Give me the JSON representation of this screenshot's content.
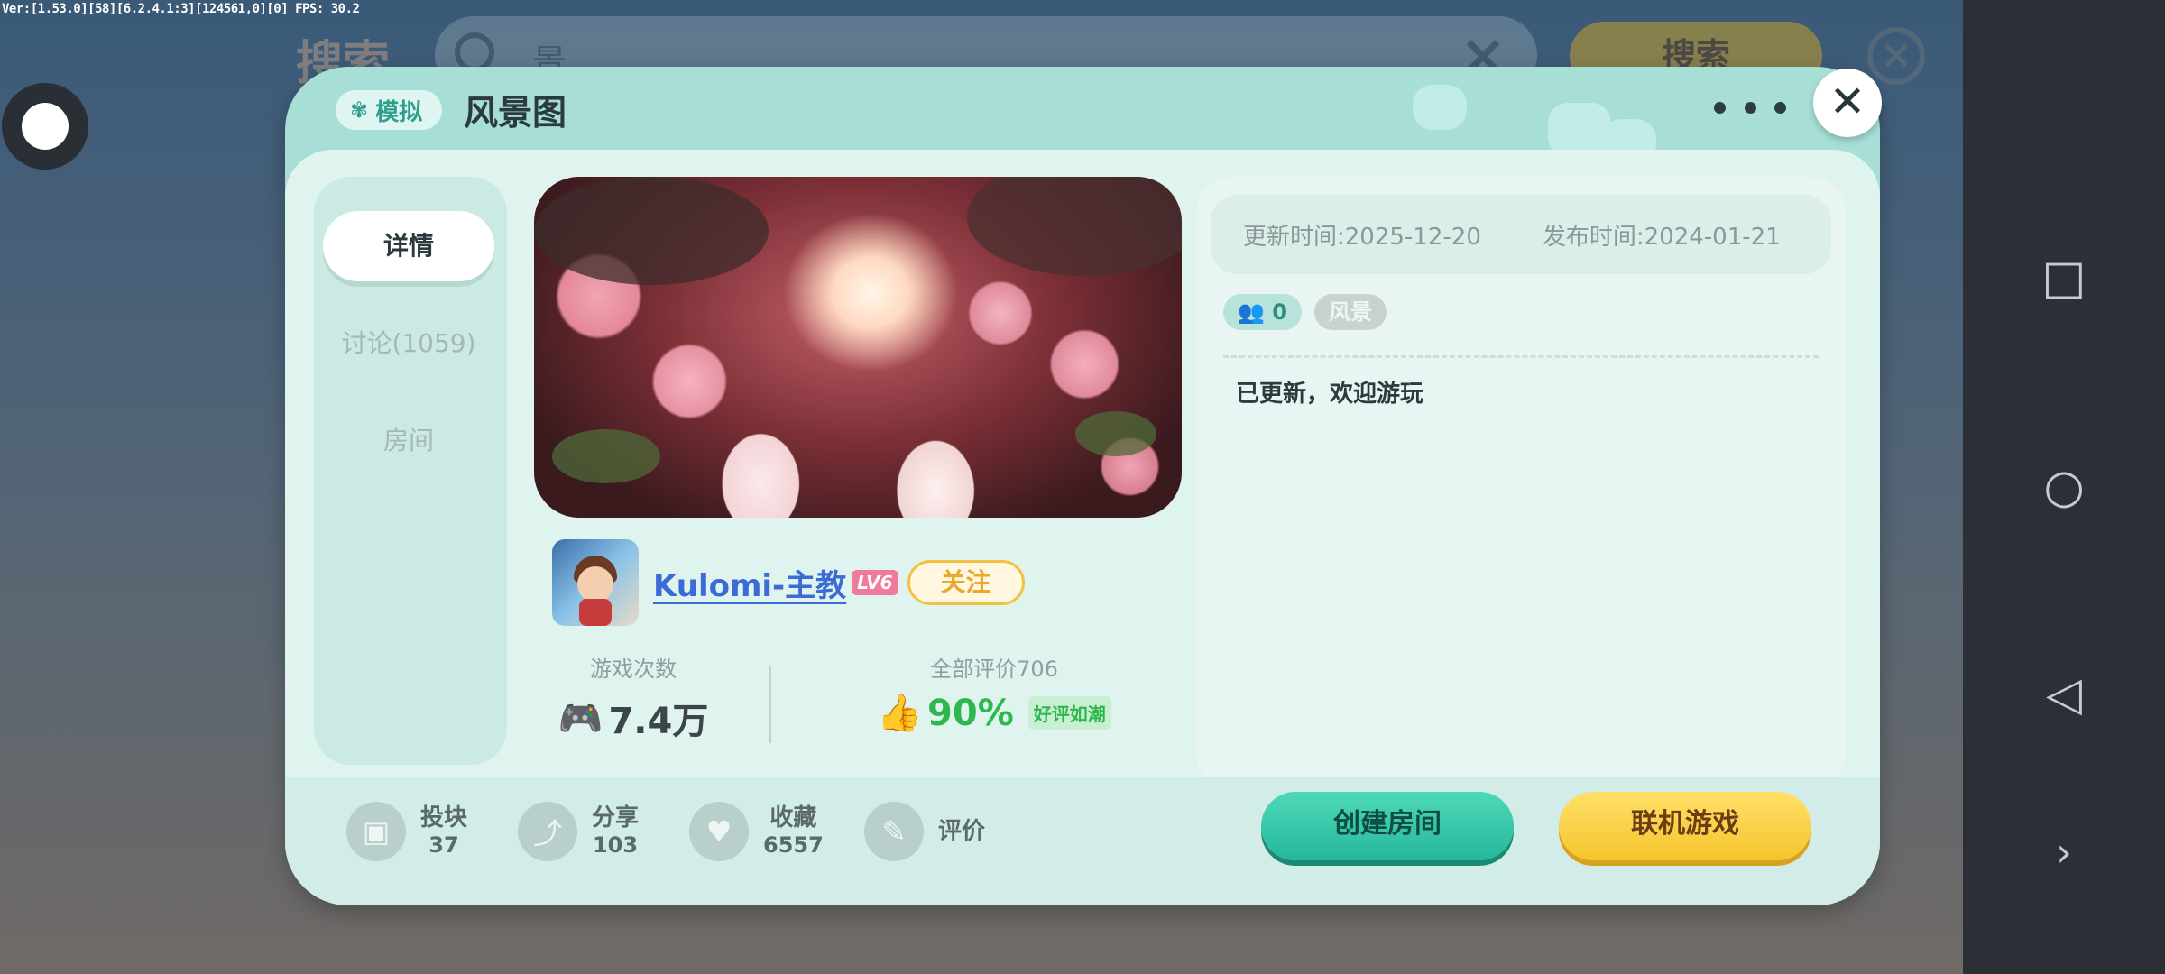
{
  "debug_overlay": "Ver:[1.53.0][58][6.2.4.1:3][124561,0][0] FPS: 30.2",
  "background": {
    "title": "搜索",
    "search_value": "景",
    "search_button": "搜索"
  },
  "header": {
    "type_tag": "模拟",
    "map_title": "风景图"
  },
  "sidebar": {
    "tabs": [
      {
        "label": "详情"
      },
      {
        "label": "讨论(1059)"
      },
      {
        "label": "房间"
      }
    ]
  },
  "author": {
    "name": "Kulomi-主教",
    "level": "LV6",
    "follow_label": "关注"
  },
  "stats": {
    "plays_label": "游戏次数",
    "plays_value": "7.4万",
    "rating_label": "全部评价706",
    "rating_value": "90%",
    "rating_tag": "好评如潮"
  },
  "info": {
    "updated": "更新时间:2025-12-20",
    "published": "发布时间:2024-01-21",
    "players_tag": "0",
    "category_tag": "风景",
    "description": "已更新，欢迎游玩"
  },
  "actions": [
    {
      "label": "投块",
      "count": "37",
      "icon": "block-icon"
    },
    {
      "label": "分享",
      "count": "103",
      "icon": "share-icon"
    },
    {
      "label": "收藏",
      "count": "6557",
      "icon": "heart-icon"
    },
    {
      "label": "评价",
      "count": "",
      "icon": "review-icon"
    }
  ],
  "buttons": {
    "create_room": "创建房间",
    "multiplayer": "联机游戏"
  },
  "colors": {
    "modal_bg": "#a7dfd7",
    "create_btn": "#25b89a",
    "play_btn": "#f5c52d",
    "good_rating": "#2db84e"
  }
}
